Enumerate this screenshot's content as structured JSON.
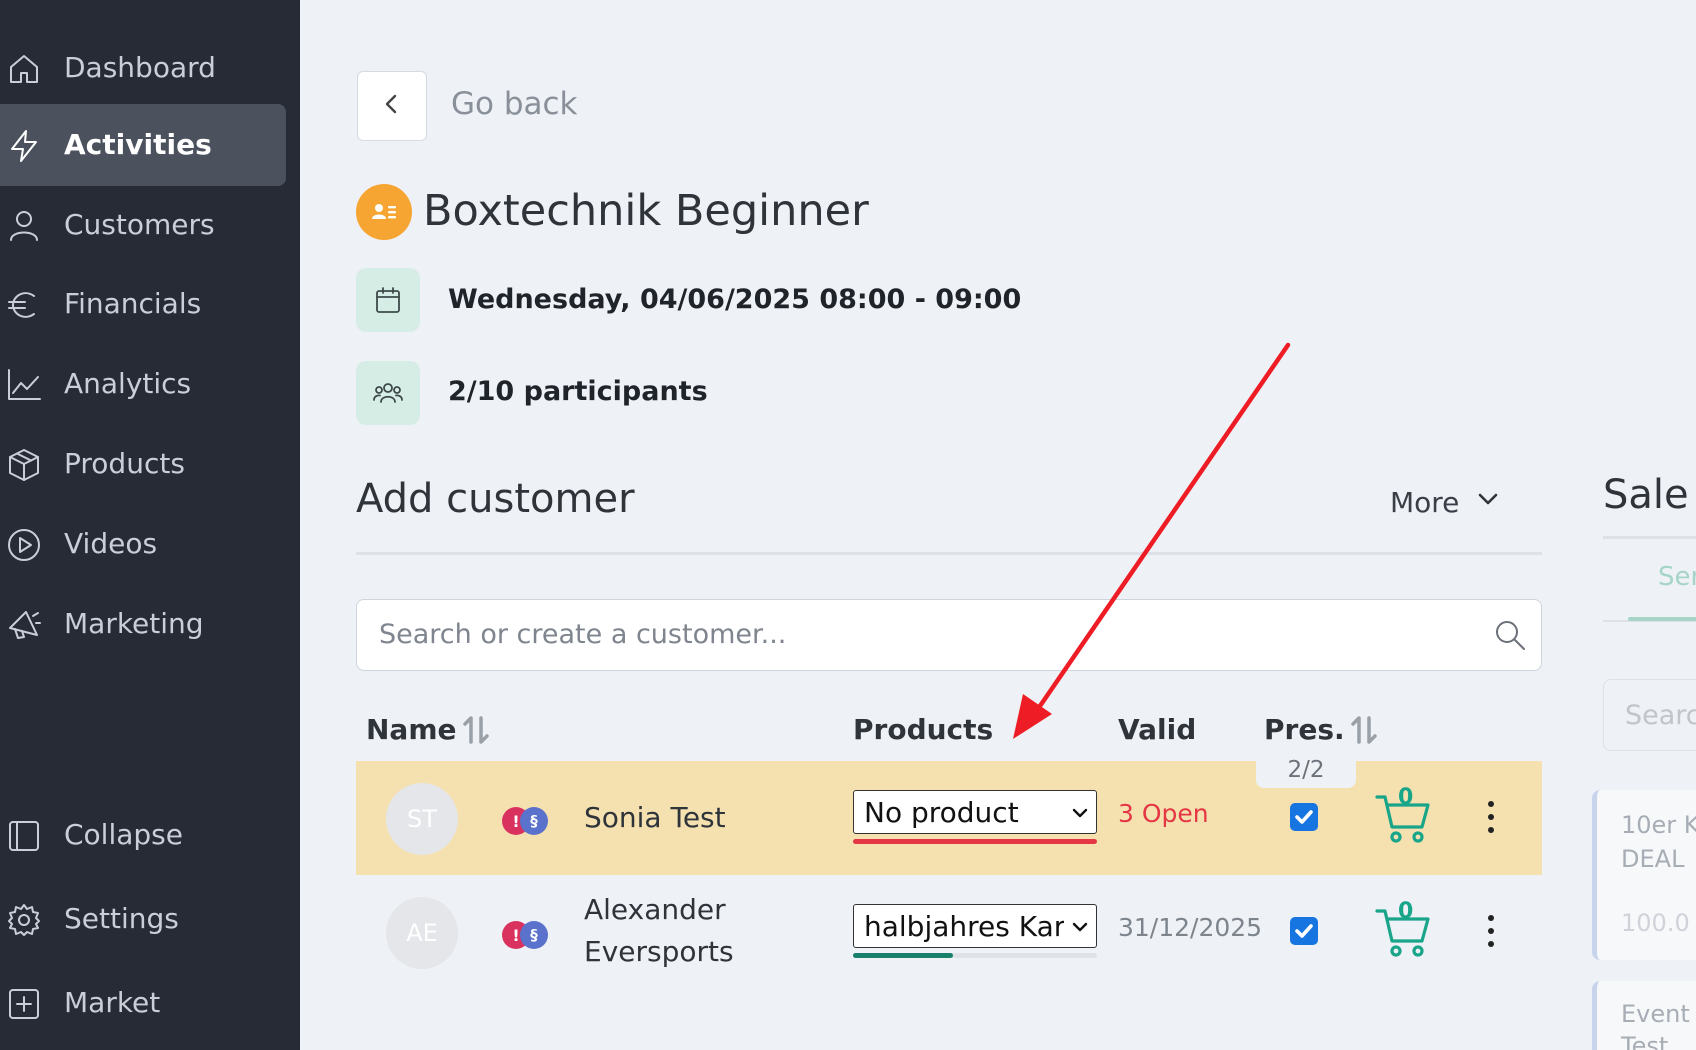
{
  "sidebar": {
    "items": [
      {
        "label": "Dashboard",
        "icon": "home-icon"
      },
      {
        "label": "Activities",
        "icon": "lightning-icon",
        "active": true
      },
      {
        "label": "Customers",
        "icon": "user-icon"
      },
      {
        "label": "Financials",
        "icon": "euro-icon"
      },
      {
        "label": "Analytics",
        "icon": "chart-line-icon"
      },
      {
        "label": "Products",
        "icon": "box-icon"
      },
      {
        "label": "Videos",
        "icon": "play-circle-icon"
      },
      {
        "label": "Marketing",
        "icon": "megaphone-icon"
      }
    ],
    "bottom_items": [
      {
        "label": "Collapse",
        "icon": "sidebar-collapse-icon"
      },
      {
        "label": "Settings",
        "icon": "gear-icon"
      },
      {
        "label": "Market",
        "icon": "plus-square-icon"
      }
    ]
  },
  "header": {
    "back_label": "Go back",
    "title": "Boxtechnik Beginner",
    "date": "Wednesday, 04/06/2025 08:00 - 09:00",
    "participants": "2/10 participants"
  },
  "add_customer": {
    "heading": "Add customer",
    "more_label": "More",
    "search_placeholder": "Search or create a customer..."
  },
  "table": {
    "headers": {
      "name": "Name",
      "products": "Products",
      "valid": "Valid",
      "pres": "Pres."
    },
    "pres_count": "2/2",
    "rows": [
      {
        "initials": "ST",
        "badge_alert": "!",
        "badge_legal": "§",
        "name_line1": "Sonia Test",
        "product": "No product",
        "valid": "3 Open",
        "present": true,
        "cart_count": "0",
        "highlight": true,
        "product_usage": 1.0
      },
      {
        "initials": "AE",
        "badge_alert": "!",
        "badge_legal": "§",
        "name_line1": "Alexander",
        "name_line2": "Eversports",
        "product": "halbjahres Karte",
        "valid": "31/12/2025",
        "present": true,
        "cart_count": "0",
        "highlight": false,
        "product_usage": 0.41
      }
    ]
  },
  "right_panel": {
    "title": "Sale t",
    "tab": "Ser",
    "search_placeholder": "Searc",
    "card1_line1": "10er K",
    "card1_line2": "DEAL",
    "card1_price": "100.0",
    "card2_line1": "Event",
    "card2_line2": "Test"
  },
  "colors": {
    "sidebar_bg": "#262b36",
    "active_bg": "#4b525e",
    "accent_orange": "#f6a532",
    "accent_teal": "#19a58a",
    "alert_red": "#e53645",
    "highlight_row": "#f5e1b0",
    "checkbox_blue": "#1675e0",
    "annotation_arrow": "#ee1c24"
  }
}
